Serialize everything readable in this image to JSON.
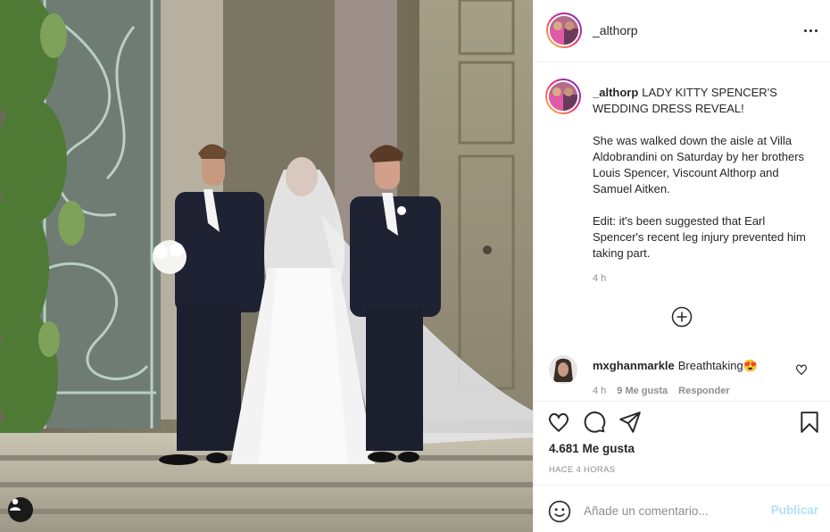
{
  "post": {
    "username": "_althorp",
    "caption_title": "LADY KITTY SPENCER'S WEDDING DRESS REVEAL!",
    "caption_para1": "She was walked down the aisle at Villa Aldobrandini on Saturday by her brothers Louis Spencer, Viscount Althorp and Samuel Aitken.",
    "caption_para2": "Edit: it's been suggested that Earl Spencer's recent leg injury prevented him taking part.",
    "caption_time": "4 h"
  },
  "comment": {
    "username": "mxghanmarkle",
    "text": "Breathtaking😍",
    "time": "4 h",
    "likes": "9 Me gusta",
    "reply": "Responder"
  },
  "stats": {
    "likes": "4.681 Me gusta",
    "timestamp": "HACE 4 HORAS"
  },
  "composer": {
    "placeholder": "Añade un comentario...",
    "publish": "Publicar"
  },
  "icons": [
    "user-tag-icon",
    "more-options-icon",
    "load-more-icon",
    "heart-icon",
    "comment-icon",
    "share-icon",
    "bookmark-icon",
    "emoji-icon"
  ],
  "colors": {
    "link_disabled": "#b2dffc",
    "secondary_text": "#8e8e8e",
    "primary_text": "#262626"
  }
}
